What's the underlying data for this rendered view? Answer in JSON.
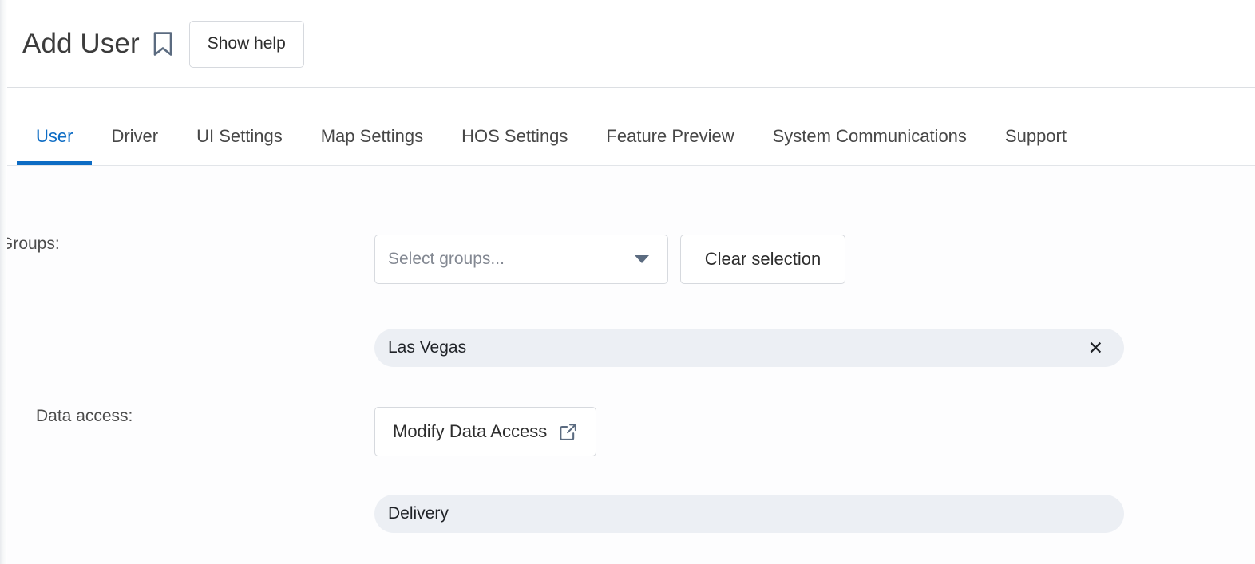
{
  "header": {
    "title": "Add User",
    "bookmark_icon": "bookmark-icon",
    "show_help_label": "Show help"
  },
  "tabs": {
    "active_index": 0,
    "items": [
      {
        "label": "User"
      },
      {
        "label": "Driver"
      },
      {
        "label": "UI Settings"
      },
      {
        "label": "Map Settings"
      },
      {
        "label": "HOS Settings"
      },
      {
        "label": "Feature Preview"
      },
      {
        "label": "System Communications"
      },
      {
        "label": "Support"
      }
    ]
  },
  "form": {
    "groups": {
      "label": "Groups:",
      "select_placeholder": "Select groups...",
      "select_value": "",
      "dropdown_icon": "chevron-down-icon",
      "clear_label": "Clear selection",
      "chips": [
        {
          "label": "Las Vegas",
          "remove_icon": "close-icon",
          "removable": true
        }
      ]
    },
    "data_access": {
      "label": "Data access:",
      "modify_label": "Modify Data Access",
      "modify_icon": "external-link-icon",
      "chips": [
        {
          "label": "Delivery",
          "removable": false
        }
      ]
    }
  },
  "colors": {
    "accent_blue": "#0d6cc4",
    "icon_slate": "#5b6b80",
    "chip_bg": "#eceff4",
    "border_gray": "#d6d9de"
  }
}
